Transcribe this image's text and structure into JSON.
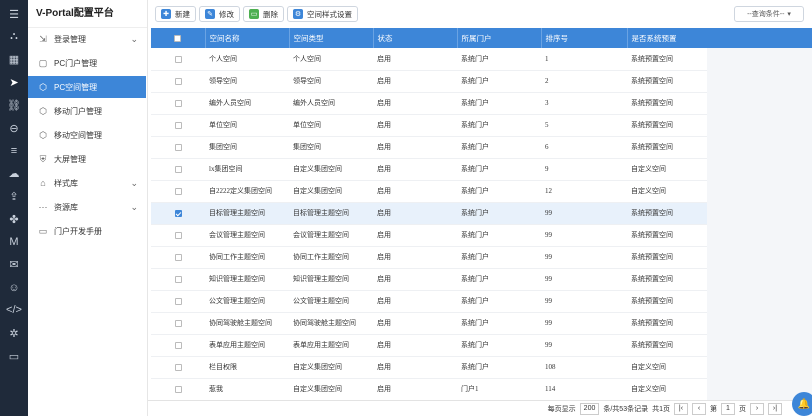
{
  "brand": "V-Portal配置平台",
  "colors": {
    "accent": "#3d86d8",
    "rail": "#1f2a3a"
  },
  "rail_icons": [
    "menu-icon",
    "sitemap-icon",
    "layout-icon",
    "send-icon",
    "link-icon",
    "minus-circle-icon",
    "layers-icon",
    "cloud-icon",
    "cloud-upload-icon",
    "grid-icon",
    "m-icon",
    "chat-icon",
    "robot-icon",
    "code-icon",
    "gear-icon",
    "monitor-icon"
  ],
  "sidebar": {
    "items": [
      {
        "label": "登录管理",
        "icon": "login-icon",
        "chevron": "⌄"
      },
      {
        "label": "PC门户管理",
        "icon": "file-icon",
        "chevron": ""
      },
      {
        "label": "PC空间管理",
        "icon": "cube-icon",
        "chevron": ""
      },
      {
        "label": "移动门户管理",
        "icon": "cube-icon",
        "chevron": ""
      },
      {
        "label": "移动空间管理",
        "icon": "cube-icon",
        "chevron": ""
      },
      {
        "label": "大屏管理",
        "icon": "shield-icon",
        "chevron": ""
      },
      {
        "label": "样式库",
        "icon": "tag-icon",
        "chevron": "⌄"
      },
      {
        "label": "资源库",
        "icon": "dots-icon",
        "chevron": "⌄"
      },
      {
        "label": "门户开发手册",
        "icon": "book-icon",
        "chevron": ""
      }
    ]
  },
  "toolbar": {
    "new_label": "新建",
    "edit_label": "修改",
    "delete_label": "删除",
    "style_label": "空间样式设置",
    "query_label": "--查询条件--"
  },
  "table": {
    "headers": [
      "空间名称",
      "空间类型",
      "状态",
      "所属门户",
      "排序号",
      "是否系统预置"
    ],
    "rows": [
      {
        "checked": false,
        "cells": [
          "个人空间",
          "个人空间",
          "启用",
          "系统门户",
          "1",
          "系统预置空间"
        ]
      },
      {
        "checked": false,
        "cells": [
          "领导空间",
          "领导空间",
          "启用",
          "系统门户",
          "2",
          "系统预置空间"
        ]
      },
      {
        "checked": false,
        "cells": [
          "编外人员空间",
          "编外人员空间",
          "启用",
          "系统门户",
          "3",
          "系统预置空间"
        ]
      },
      {
        "checked": false,
        "cells": [
          "单位空间",
          "单位空间",
          "启用",
          "系统门户",
          "5",
          "系统预置空间"
        ]
      },
      {
        "checked": false,
        "cells": [
          "集团空间",
          "集团空间",
          "启用",
          "系统门户",
          "6",
          "系统预置空间"
        ]
      },
      {
        "checked": false,
        "cells": [
          "lx集团空间",
          "自定义集团空间",
          "启用",
          "系统门户",
          "9",
          "自定义空间"
        ]
      },
      {
        "checked": false,
        "cells": [
          "自2222定义集团空间",
          "自定义集团空间",
          "启用",
          "系统门户",
          "12",
          "自定义空间"
        ]
      },
      {
        "checked": true,
        "cells": [
          "目标管理主题空间",
          "目标管理主题空间",
          "启用",
          "系统门户",
          "99",
          "系统预置空间"
        ]
      },
      {
        "checked": false,
        "cells": [
          "会议管理主题空间",
          "会议管理主题空间",
          "启用",
          "系统门户",
          "99",
          "系统预置空间"
        ]
      },
      {
        "checked": false,
        "cells": [
          "协同工作主题空间",
          "协同工作主题空间",
          "启用",
          "系统门户",
          "99",
          "系统预置空间"
        ]
      },
      {
        "checked": false,
        "cells": [
          "知识管理主题空间",
          "知识管理主题空间",
          "启用",
          "系统门户",
          "99",
          "系统预置空间"
        ]
      },
      {
        "checked": false,
        "cells": [
          "公文管理主题空间",
          "公文管理主题空间",
          "启用",
          "系统门户",
          "99",
          "系统预置空间"
        ]
      },
      {
        "checked": false,
        "cells": [
          "协同驾驶舱主题空间",
          "协同驾驶舱主题空间",
          "启用",
          "系统门户",
          "99",
          "系统预置空间"
        ]
      },
      {
        "checked": false,
        "cells": [
          "表单应用主题空间",
          "表单应用主题空间",
          "启用",
          "系统门户",
          "99",
          "系统预置空间"
        ]
      },
      {
        "checked": false,
        "cells": [
          "栏目权限",
          "自定义集团空间",
          "启用",
          "系统门户",
          "108",
          "自定义空间"
        ]
      },
      {
        "checked": false,
        "cells": [
          "惹我",
          "自定义集团空间",
          "启用",
          "门户1",
          "114",
          "自定义空间"
        ]
      }
    ]
  },
  "pager": {
    "per_page_label": "每页显示",
    "per_page": "200",
    "total_label": "条/共53条记录",
    "pages_label": "共1页",
    "page_prefix": "第",
    "page": "1",
    "page_suffix": "页"
  }
}
